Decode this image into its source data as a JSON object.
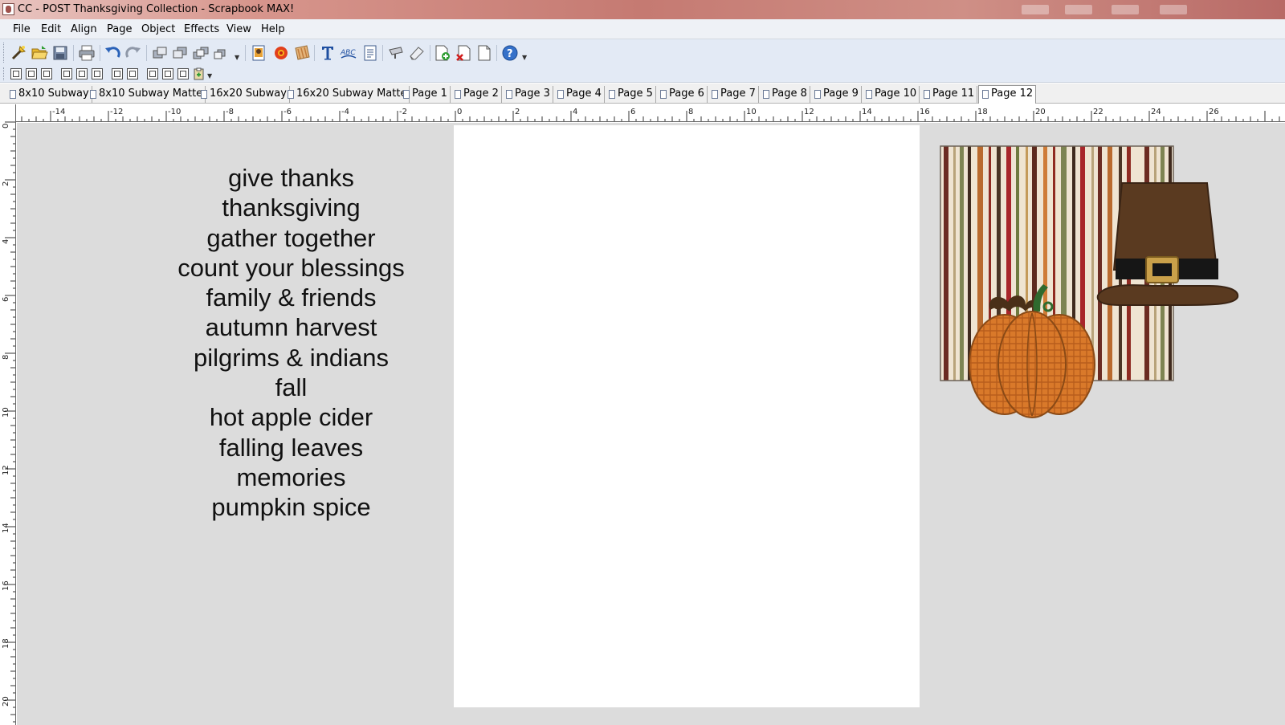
{
  "window": {
    "title": "CC - POST Thanksgiving Collection - Scrapbook MAX!"
  },
  "menu": [
    "File",
    "Edit",
    "Align",
    "Page",
    "Object",
    "Effects",
    "View",
    "Help"
  ],
  "toolbar": {
    "icons": [
      "new-project-icon",
      "open-icon",
      "save-icon",
      "print-icon",
      "undo-icon",
      "redo-icon",
      "bring-forward-icon",
      "send-backward-icon",
      "bring-to-front-icon",
      "send-to-back-icon",
      "add-photo-icon",
      "add-embellishment-icon",
      "add-paper-icon",
      "add-text-icon",
      "word-art-icon",
      "journal-icon",
      "stamp-icon",
      "eraser-icon",
      "add-page-icon",
      "delete-page-icon",
      "duplicate-page-icon",
      "help-icon"
    ],
    "align_icons": [
      "align-left-icon",
      "align-center-icon",
      "align-right-icon",
      "align-top-icon",
      "align-middle-icon",
      "align-bottom-icon",
      "space-horizontal-icon",
      "space-vertical-icon",
      "group-icon",
      "ungroup-icon",
      "lock-icon",
      "paste-icon"
    ]
  },
  "tabs": [
    {
      "label": "8x10 Subway",
      "active": false
    },
    {
      "label": "8x10 Subway Matte",
      "active": false
    },
    {
      "label": "16x20 Subway",
      "active": false
    },
    {
      "label": "16x20 Subway Matte",
      "active": false
    },
    {
      "label": "Page 1",
      "active": false
    },
    {
      "label": "Page 2",
      "active": false
    },
    {
      "label": "Page 3",
      "active": false
    },
    {
      "label": "Page 4",
      "active": false
    },
    {
      "label": "Page 5",
      "active": false
    },
    {
      "label": "Page 6",
      "active": false
    },
    {
      "label": "Page 7",
      "active": false
    },
    {
      "label": "Page 8",
      "active": false
    },
    {
      "label": "Page 9",
      "active": false
    },
    {
      "label": "Page 10",
      "active": false
    },
    {
      "label": "Page 11",
      "active": false
    },
    {
      "label": "Page 12",
      "active": true
    }
  ],
  "ruler": {
    "horizontal_labels": [
      "-14",
      "-12",
      "-10",
      "-8",
      "-6",
      "-4",
      "-2",
      "0",
      "2",
      "4",
      "6",
      "8",
      "10",
      "12",
      "14",
      "16",
      "18",
      "20",
      "22",
      "24",
      "26"
    ],
    "vertical_labels": [
      "0",
      "2",
      "4",
      "6",
      "8",
      "10",
      "12",
      "14",
      "16",
      "18",
      "20"
    ]
  },
  "canvas": {
    "words": [
      "give thanks",
      "thanksgiving",
      "gather together",
      "count your blessings",
      "family & friends",
      "autumn harvest",
      "pilgrims & indians",
      "fall",
      "hot apple cider",
      "falling leaves",
      "memories",
      "pumpkin spice"
    ],
    "artwork": [
      "striped-paper",
      "pumpkin",
      "pilgrim-hat"
    ]
  },
  "colors": {
    "workspace": "#dcdcdc",
    "page": "#ffffff",
    "toolbar": "#e3eaf5",
    "menubar": "#eef1f6"
  }
}
